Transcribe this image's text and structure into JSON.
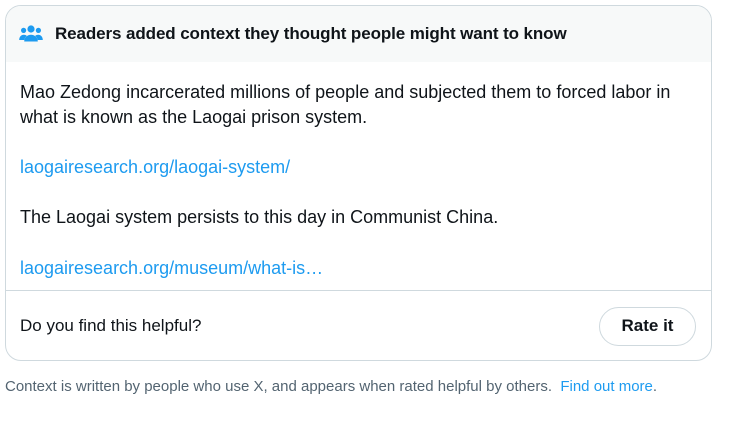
{
  "header": {
    "icon": "people-group-icon",
    "icon_color": "#1d9bf0",
    "title": "Readers added context they thought people might want to know"
  },
  "body": {
    "paragraph_1": "Mao Zedong incarcerated millions of people and subjected them to forced labor in what is known as the Laogai prison system.",
    "link_1": "laogairesearch.org/laogai-system/",
    "paragraph_2": "The Laogai system persists to this day in Communist China.",
    "link_2": "laogairesearch.org/museum/what-is…"
  },
  "footer": {
    "question": "Do you find this helpful?",
    "rate_label": "Rate it"
  },
  "disclaimer": {
    "text": "Context is written by people who use X, and appears when rated helpful by others.",
    "link_text": "Find out more",
    "after_link": "."
  },
  "colors": {
    "accent": "#1d9bf0",
    "header_bg": "#f7f9f9",
    "border": "#cfd9de",
    "secondary_text": "#536471"
  }
}
